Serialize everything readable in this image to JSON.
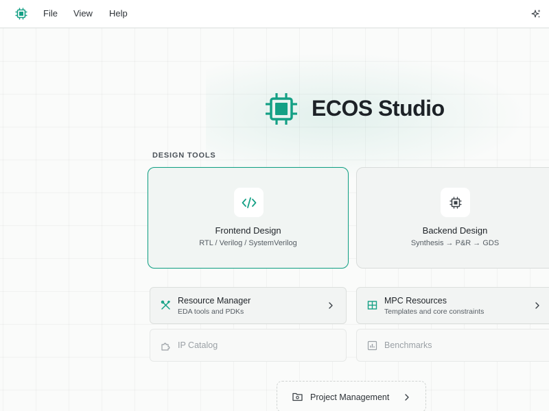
{
  "menu": {
    "file": "File",
    "view": "View",
    "help": "Help"
  },
  "hero": {
    "title": "ECOS Studio"
  },
  "section": {
    "label": "DESIGN TOOLS"
  },
  "cards": [
    {
      "title": "Frontend Design",
      "subtitle": "RTL / Verilog / SystemVerilog",
      "icon": "code-icon"
    },
    {
      "title": "Backend Design",
      "subtitle": "Synthesis → P&R → GDS",
      "icon": "chip-icon"
    }
  ],
  "resources": [
    {
      "title": "Resource Manager",
      "subtitle": "EDA tools and PDKs",
      "icon": "tools-icon"
    },
    {
      "title": "MPC Resources",
      "subtitle": "Templates and core constraints",
      "icon": "grid-icon"
    }
  ],
  "disabled": [
    {
      "title": "IP Catalog",
      "icon": "puzzle-icon"
    },
    {
      "title": "Benchmarks",
      "icon": "chart-icon"
    }
  ],
  "project": {
    "label": "Project Management",
    "icon": "folder-icon"
  },
  "colors": {
    "accent": "#14a085",
    "text": "#1d2227",
    "muted": "#555c63"
  }
}
